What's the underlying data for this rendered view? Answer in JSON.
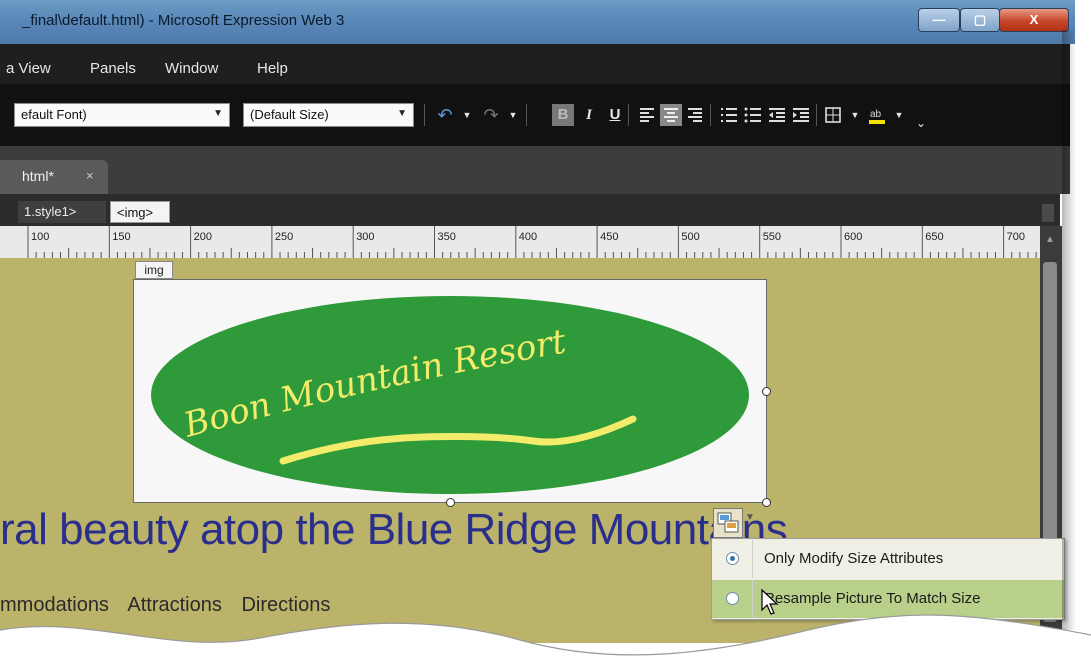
{
  "window": {
    "title": "_final\\default.html) - Microsoft Expression Web 3",
    "minimize_glyph": "—",
    "maximize_glyph": "▢",
    "close_glyph": "X"
  },
  "menu": [
    "a View",
    "Panels",
    "Window",
    "Help"
  ],
  "toolbar": {
    "font_select": "efault Font)",
    "size_select": "(Default Size)",
    "undo_icon": "↶",
    "redo_icon": "↷",
    "bold": "B",
    "italic": "I",
    "underline": "U",
    "dropdown_glyph": "▼",
    "overflow_glyph": "⌄"
  },
  "tab": {
    "label": "html*",
    "close": "×"
  },
  "breadcrumb": {
    "item1": "1.style1>",
    "item2": "<img>"
  },
  "ruler": {
    "labels": [
      "100",
      "150",
      "200",
      "250",
      "300",
      "350",
      "400",
      "450",
      "500",
      "550",
      "600",
      "650",
      "700"
    ]
  },
  "image": {
    "tag_label": "img",
    "logo_text": "Boon Mountain Resort",
    "ellipse_color": "#2f9a3a",
    "logo_text_color": "#f2ec6a"
  },
  "page": {
    "heading": "ral beauty atop the Blue Ridge Mountains",
    "nav": [
      "mmodations",
      "Attractions",
      "Directions"
    ]
  },
  "smart_tag_menu": {
    "options": [
      {
        "label": "Only Modify Size Attributes",
        "selected": true
      },
      {
        "label": "Resample Picture To Match Size",
        "selected": false,
        "highlighted": true
      }
    ]
  },
  "colors": {
    "canvas_bg": "#bcb36b",
    "heading_color": "#2b2f8c",
    "menu_highlight": "#b8d089",
    "chrome_dark": "#1f1f1f"
  }
}
